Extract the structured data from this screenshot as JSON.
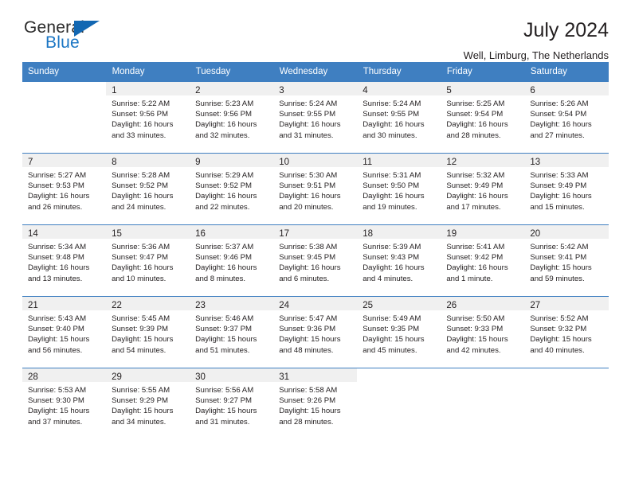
{
  "logo": {
    "word1": "General",
    "word2": "Blue",
    "triangle_color": "#1267b2",
    "word2_color": "#1b76c4"
  },
  "header": {
    "title": "July 2024",
    "subtitle": "Well, Limburg, The Netherlands",
    "header_bg": "#3f7fc1",
    "daynum_bg": "#f0f0f0"
  },
  "weekdays": [
    "Sunday",
    "Monday",
    "Tuesday",
    "Wednesday",
    "Thursday",
    "Friday",
    "Saturday"
  ],
  "weeks": [
    [
      {
        "day": "",
        "lines": []
      },
      {
        "day": "1",
        "lines": [
          "Sunrise: 5:22 AM",
          "Sunset: 9:56 PM",
          "Daylight: 16 hours",
          "and 33 minutes."
        ]
      },
      {
        "day": "2",
        "lines": [
          "Sunrise: 5:23 AM",
          "Sunset: 9:56 PM",
          "Daylight: 16 hours",
          "and 32 minutes."
        ]
      },
      {
        "day": "3",
        "lines": [
          "Sunrise: 5:24 AM",
          "Sunset: 9:55 PM",
          "Daylight: 16 hours",
          "and 31 minutes."
        ]
      },
      {
        "day": "4",
        "lines": [
          "Sunrise: 5:24 AM",
          "Sunset: 9:55 PM",
          "Daylight: 16 hours",
          "and 30 minutes."
        ]
      },
      {
        "day": "5",
        "lines": [
          "Sunrise: 5:25 AM",
          "Sunset: 9:54 PM",
          "Daylight: 16 hours",
          "and 28 minutes."
        ]
      },
      {
        "day": "6",
        "lines": [
          "Sunrise: 5:26 AM",
          "Sunset: 9:54 PM",
          "Daylight: 16 hours",
          "and 27 minutes."
        ]
      }
    ],
    [
      {
        "day": "7",
        "lines": [
          "Sunrise: 5:27 AM",
          "Sunset: 9:53 PM",
          "Daylight: 16 hours",
          "and 26 minutes."
        ]
      },
      {
        "day": "8",
        "lines": [
          "Sunrise: 5:28 AM",
          "Sunset: 9:52 PM",
          "Daylight: 16 hours",
          "and 24 minutes."
        ]
      },
      {
        "day": "9",
        "lines": [
          "Sunrise: 5:29 AM",
          "Sunset: 9:52 PM",
          "Daylight: 16 hours",
          "and 22 minutes."
        ]
      },
      {
        "day": "10",
        "lines": [
          "Sunrise: 5:30 AM",
          "Sunset: 9:51 PM",
          "Daylight: 16 hours",
          "and 20 minutes."
        ]
      },
      {
        "day": "11",
        "lines": [
          "Sunrise: 5:31 AM",
          "Sunset: 9:50 PM",
          "Daylight: 16 hours",
          "and 19 minutes."
        ]
      },
      {
        "day": "12",
        "lines": [
          "Sunrise: 5:32 AM",
          "Sunset: 9:49 PM",
          "Daylight: 16 hours",
          "and 17 minutes."
        ]
      },
      {
        "day": "13",
        "lines": [
          "Sunrise: 5:33 AM",
          "Sunset: 9:49 PM",
          "Daylight: 16 hours",
          "and 15 minutes."
        ]
      }
    ],
    [
      {
        "day": "14",
        "lines": [
          "Sunrise: 5:34 AM",
          "Sunset: 9:48 PM",
          "Daylight: 16 hours",
          "and 13 minutes."
        ]
      },
      {
        "day": "15",
        "lines": [
          "Sunrise: 5:36 AM",
          "Sunset: 9:47 PM",
          "Daylight: 16 hours",
          "and 10 minutes."
        ]
      },
      {
        "day": "16",
        "lines": [
          "Sunrise: 5:37 AM",
          "Sunset: 9:46 PM",
          "Daylight: 16 hours",
          "and 8 minutes."
        ]
      },
      {
        "day": "17",
        "lines": [
          "Sunrise: 5:38 AM",
          "Sunset: 9:45 PM",
          "Daylight: 16 hours",
          "and 6 minutes."
        ]
      },
      {
        "day": "18",
        "lines": [
          "Sunrise: 5:39 AM",
          "Sunset: 9:43 PM",
          "Daylight: 16 hours",
          "and 4 minutes."
        ]
      },
      {
        "day": "19",
        "lines": [
          "Sunrise: 5:41 AM",
          "Sunset: 9:42 PM",
          "Daylight: 16 hours",
          "and 1 minute."
        ]
      },
      {
        "day": "20",
        "lines": [
          "Sunrise: 5:42 AM",
          "Sunset: 9:41 PM",
          "Daylight: 15 hours",
          "and 59 minutes."
        ]
      }
    ],
    [
      {
        "day": "21",
        "lines": [
          "Sunrise: 5:43 AM",
          "Sunset: 9:40 PM",
          "Daylight: 15 hours",
          "and 56 minutes."
        ]
      },
      {
        "day": "22",
        "lines": [
          "Sunrise: 5:45 AM",
          "Sunset: 9:39 PM",
          "Daylight: 15 hours",
          "and 54 minutes."
        ]
      },
      {
        "day": "23",
        "lines": [
          "Sunrise: 5:46 AM",
          "Sunset: 9:37 PM",
          "Daylight: 15 hours",
          "and 51 minutes."
        ]
      },
      {
        "day": "24",
        "lines": [
          "Sunrise: 5:47 AM",
          "Sunset: 9:36 PM",
          "Daylight: 15 hours",
          "and 48 minutes."
        ]
      },
      {
        "day": "25",
        "lines": [
          "Sunrise: 5:49 AM",
          "Sunset: 9:35 PM",
          "Daylight: 15 hours",
          "and 45 minutes."
        ]
      },
      {
        "day": "26",
        "lines": [
          "Sunrise: 5:50 AM",
          "Sunset: 9:33 PM",
          "Daylight: 15 hours",
          "and 42 minutes."
        ]
      },
      {
        "day": "27",
        "lines": [
          "Sunrise: 5:52 AM",
          "Sunset: 9:32 PM",
          "Daylight: 15 hours",
          "and 40 minutes."
        ]
      }
    ],
    [
      {
        "day": "28",
        "lines": [
          "Sunrise: 5:53 AM",
          "Sunset: 9:30 PM",
          "Daylight: 15 hours",
          "and 37 minutes."
        ]
      },
      {
        "day": "29",
        "lines": [
          "Sunrise: 5:55 AM",
          "Sunset: 9:29 PM",
          "Daylight: 15 hours",
          "and 34 minutes."
        ]
      },
      {
        "day": "30",
        "lines": [
          "Sunrise: 5:56 AM",
          "Sunset: 9:27 PM",
          "Daylight: 15 hours",
          "and 31 minutes."
        ]
      },
      {
        "day": "31",
        "lines": [
          "Sunrise: 5:58 AM",
          "Sunset: 9:26 PM",
          "Daylight: 15 hours",
          "and 28 minutes."
        ]
      },
      {
        "day": "",
        "lines": []
      },
      {
        "day": "",
        "lines": []
      },
      {
        "day": "",
        "lines": []
      }
    ]
  ]
}
